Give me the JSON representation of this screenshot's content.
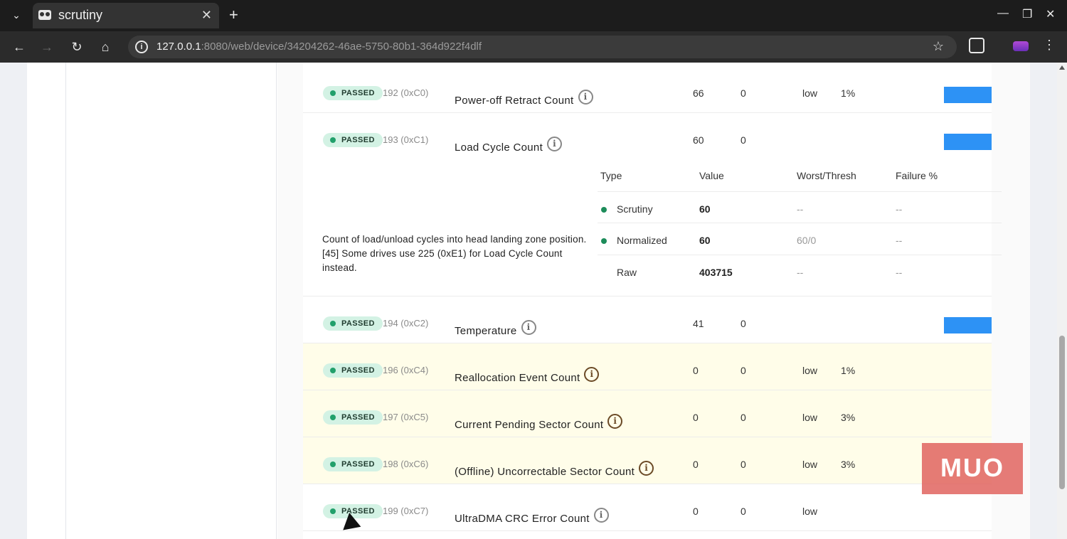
{
  "browser": {
    "tab_title": "scrutiny",
    "tab_menu_icon": "chevron-down-icon",
    "close_glyph": "✕",
    "new_tab_glyph": "+",
    "url_host": "127.0.0.1",
    "url_rest": ":8080/web/device/34204262-46ae-5750-80b1-364d922f4dlf",
    "window_controls": [
      "—",
      "❐",
      "✕"
    ]
  },
  "colors": {
    "passed_badge_bg": "#d3f2e4",
    "passed_dot": "#22a06b",
    "warn_row_bg": "#fffde9",
    "bar_blue": "#2d92f5"
  },
  "attributes": [
    {
      "status": "PASSED",
      "id": "192 (0xC0)",
      "name": "Power-off Retract Count",
      "value": "66",
      "worst": "0",
      "ideal": "low",
      "failure": "1%",
      "warn": false,
      "has_bar": true
    },
    {
      "status": "PASSED",
      "id": "193 (0xC1)",
      "name": "Load Cycle Count",
      "value": "60",
      "worst": "0",
      "ideal": "",
      "failure": "",
      "warn": false,
      "has_bar": true
    },
    {
      "status": "PASSED",
      "id": "194 (0xC2)",
      "name": "Temperature",
      "value": "41",
      "worst": "0",
      "ideal": "",
      "failure": "",
      "warn": false,
      "has_bar": true
    },
    {
      "status": "PASSED",
      "id": "196 (0xC4)",
      "name": "Reallocation Event Count",
      "value": "0",
      "worst": "0",
      "ideal": "low",
      "failure": "1%",
      "warn": true,
      "has_bar": false
    },
    {
      "status": "PASSED",
      "id": "197 (0xC5)",
      "name": "Current Pending Sector Count",
      "value": "0",
      "worst": "0",
      "ideal": "low",
      "failure": "3%",
      "warn": true,
      "has_bar": false
    },
    {
      "status": "PASSED",
      "id": "198 (0xC6)",
      "name": "(Offline) Uncorrectable Sector Count",
      "value": "0",
      "worst": "0",
      "ideal": "low",
      "failure": "3%",
      "warn": true,
      "has_bar": false
    },
    {
      "status": "PASSED",
      "id": "199 (0xC7)",
      "name": "UltraDMA CRC Error Count",
      "value": "0",
      "worst": "0",
      "ideal": "low",
      "failure": "",
      "warn": false,
      "has_bar": false
    }
  ],
  "detail": {
    "description": "Count of load/unload cycles into head landing zone position.[45] Some drives use 225 (0xE1) for Load Cycle Count instead.",
    "headers": {
      "type": "Type",
      "value": "Value",
      "worst": "Worst/Thresh",
      "failure": "Failure %"
    },
    "rows": [
      {
        "type": "Scrutiny",
        "value": "60",
        "worst": "--",
        "failure": "--",
        "dot": true
      },
      {
        "type": "Normalized",
        "value": "60",
        "worst": "60/0",
        "failure": "--",
        "dot": true
      },
      {
        "type": "Raw",
        "value": "403715",
        "worst": "--",
        "failure": "--",
        "dot": false
      }
    ]
  },
  "watermark": "MUO"
}
